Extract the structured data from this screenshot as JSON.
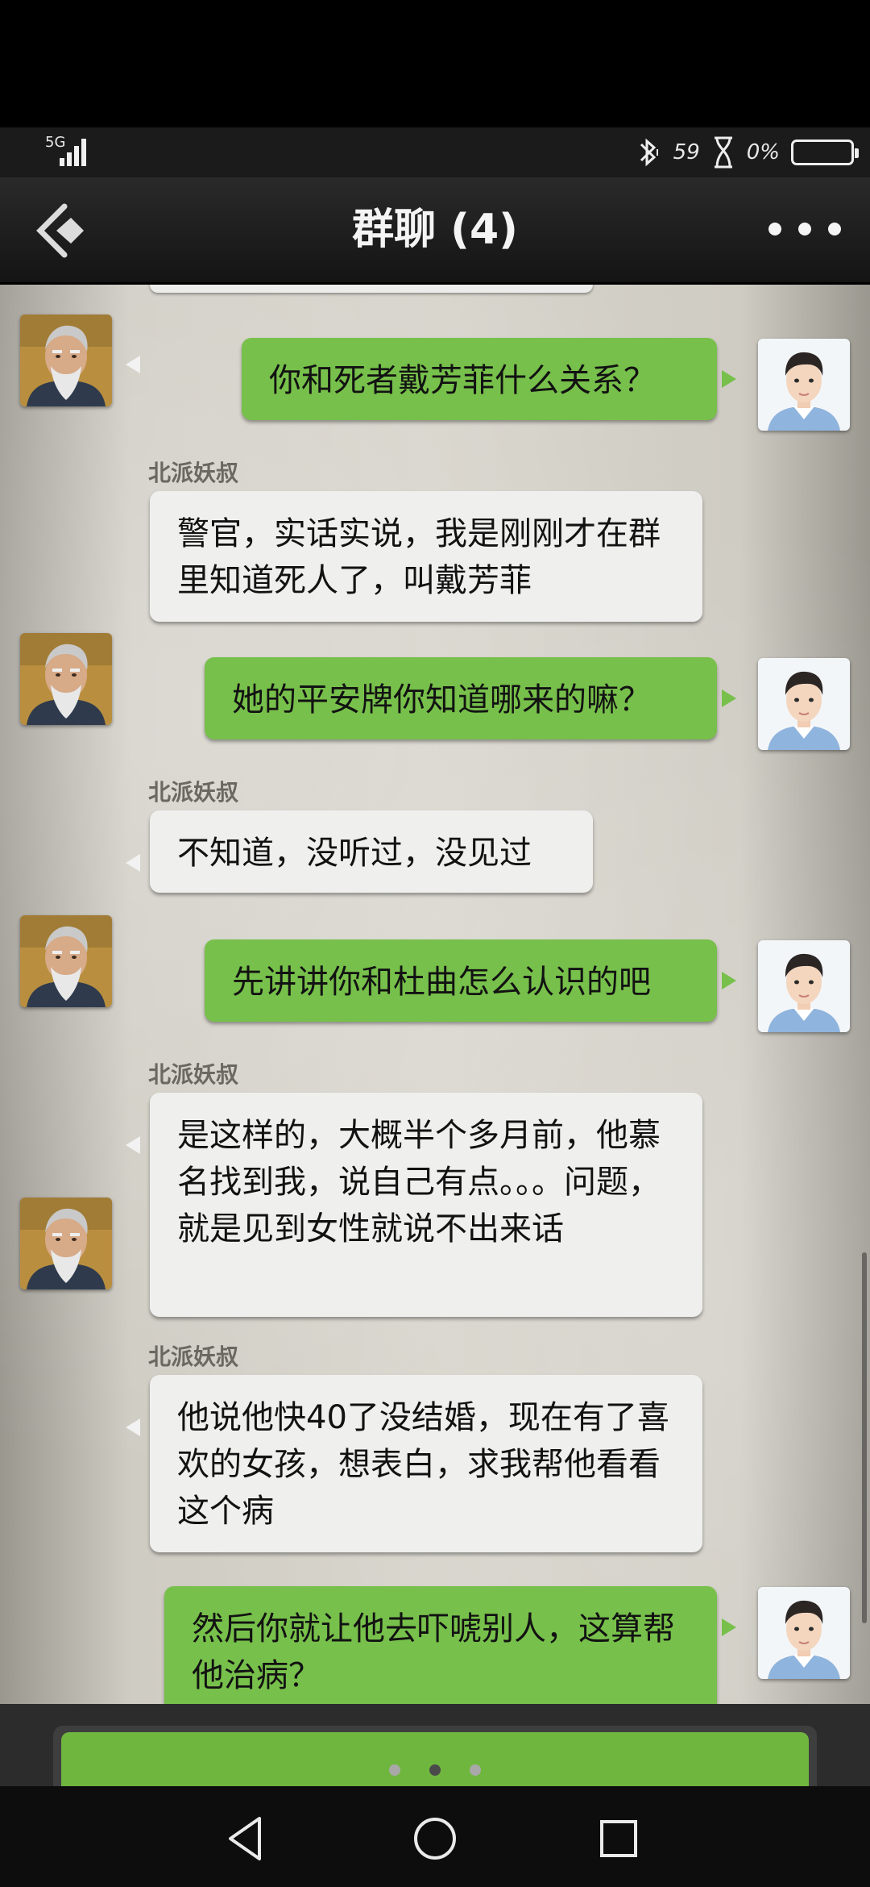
{
  "status_bar": {
    "network": "5G",
    "signal_text": "59",
    "battery_text": "0%"
  },
  "header": {
    "title": "群聊 (4)"
  },
  "messages": [
    {
      "side": "right",
      "text": "你和死者戴芳菲什么关系？"
    },
    {
      "side": "left",
      "sender": "北派妖叔",
      "text": "警官，实话实说，我是刚刚才在群里知道死人了，叫戴芳菲"
    },
    {
      "side": "right",
      "text": "她的平安牌你知道哪来的嘛？"
    },
    {
      "side": "left",
      "sender": "北派妖叔",
      "text": "不知道，没听过，没见过"
    },
    {
      "side": "right",
      "text": "先讲讲你和杜曲怎么认识的吧"
    },
    {
      "side": "left",
      "sender": "北派妖叔",
      "text": "是这样的，大概半个多月前，他慕名找到我，说自己有点。。。问题，就是见到女性就说不出来话"
    },
    {
      "side": "left",
      "sender": "北派妖叔",
      "text": "他说他快40了没结婚，现在有了喜欢的女孩，想表白，求我帮他看看这个病"
    },
    {
      "side": "right",
      "text": "然后你就让他去吓唬别人，这算帮他治病？"
    }
  ],
  "input": {
    "page_dots": 3,
    "active_dot": 1
  },
  "colors": {
    "accent_green": "#77c04b",
    "bubble_white": "#efefee",
    "header_bg": "#1b1b1b"
  }
}
